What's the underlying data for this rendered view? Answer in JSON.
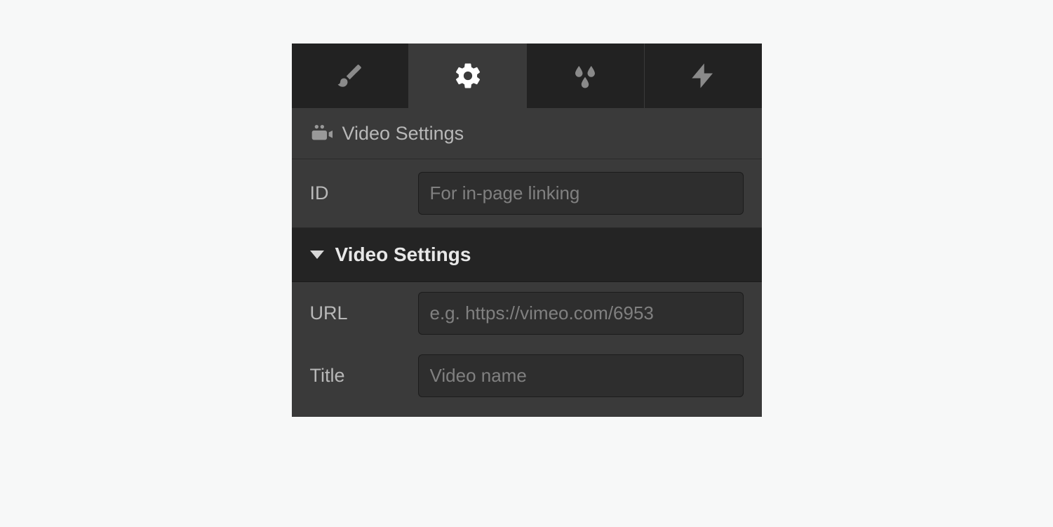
{
  "tabs": {
    "style": {
      "icon": "brush-icon",
      "active": false
    },
    "settings": {
      "icon": "gear-icon",
      "active": true
    },
    "effects": {
      "icon": "droplets-icon",
      "active": false
    },
    "interactions": {
      "icon": "bolt-icon",
      "active": false
    }
  },
  "panel_header": {
    "icon": "video-camera-icon",
    "title": "Video Settings"
  },
  "id_field": {
    "label": "ID",
    "placeholder": "For in-page linking",
    "value": ""
  },
  "section": {
    "title": "Video Settings",
    "expanded": true
  },
  "url_field": {
    "label": "URL",
    "placeholder": "e.g. https://vimeo.com/6953",
    "value": ""
  },
  "title_field": {
    "label": "Title",
    "placeholder": "Video name",
    "value": ""
  }
}
